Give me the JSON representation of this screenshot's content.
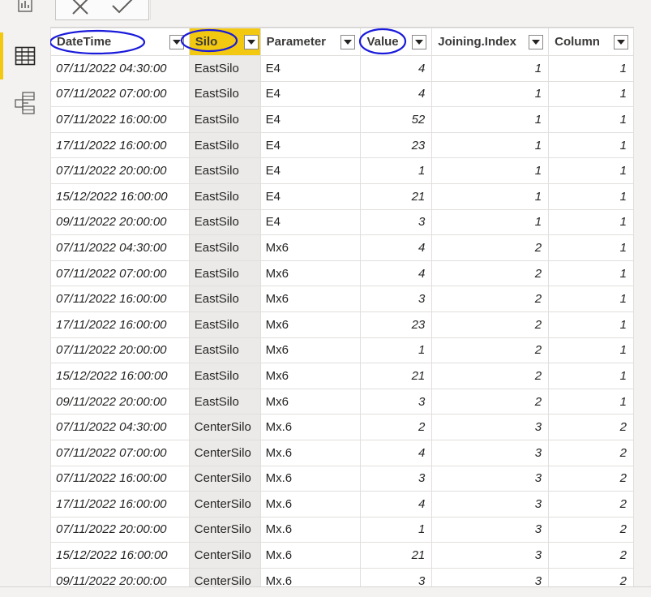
{
  "left_rail": {
    "items": [
      {
        "icon": "report-view-icon",
        "active": false
      },
      {
        "icon": "data-view-icon",
        "active": true
      },
      {
        "icon": "model-view-icon",
        "active": false
      }
    ]
  },
  "formula_bar": {
    "cancel_icon": "close-icon",
    "commit_icon": "check-icon"
  },
  "colors": {
    "accent": "#f2c811",
    "annotation_ink": "#1a1adb",
    "selected_column_bg": "#ebeae9"
  },
  "table": {
    "columns": [
      "DateTime",
      "Silo",
      "Parameter",
      "Value",
      "Joining.Index",
      "Column"
    ],
    "selected_column": "Silo",
    "rows": [
      [
        "07/11/2022 04:30:00",
        "EastSilo",
        "E4",
        "4",
        "1",
        "1"
      ],
      [
        "07/11/2022 07:00:00",
        "EastSilo",
        "E4",
        "4",
        "1",
        "1"
      ],
      [
        "07/11/2022 16:00:00",
        "EastSilo",
        "E4",
        "52",
        "1",
        "1"
      ],
      [
        "17/11/2022 16:00:00",
        "EastSilo",
        "E4",
        "23",
        "1",
        "1"
      ],
      [
        "07/11/2022 20:00:00",
        "EastSilo",
        "E4",
        "1",
        "1",
        "1"
      ],
      [
        "15/12/2022 16:00:00",
        "EastSilo",
        "E4",
        "21",
        "1",
        "1"
      ],
      [
        "09/11/2022 20:00:00",
        "EastSilo",
        "E4",
        "3",
        "1",
        "1"
      ],
      [
        "07/11/2022 04:30:00",
        "EastSilo",
        "Mx6",
        "4",
        "2",
        "1"
      ],
      [
        "07/11/2022 07:00:00",
        "EastSilo",
        "Mx6",
        "4",
        "2",
        "1"
      ],
      [
        "07/11/2022 16:00:00",
        "EastSilo",
        "Mx6",
        "3",
        "2",
        "1"
      ],
      [
        "17/11/2022 16:00:00",
        "EastSilo",
        "Mx6",
        "23",
        "2",
        "1"
      ],
      [
        "07/11/2022 20:00:00",
        "EastSilo",
        "Mx6",
        "1",
        "2",
        "1"
      ],
      [
        "15/12/2022 16:00:00",
        "EastSilo",
        "Mx6",
        "21",
        "2",
        "1"
      ],
      [
        "09/11/2022 20:00:00",
        "EastSilo",
        "Mx6",
        "3",
        "2",
        "1"
      ],
      [
        "07/11/2022 04:30:00",
        "CenterSilo",
        "Mx.6",
        "2",
        "3",
        "2"
      ],
      [
        "07/11/2022 07:00:00",
        "CenterSilo",
        "Mx.6",
        "4",
        "3",
        "2"
      ],
      [
        "07/11/2022 16:00:00",
        "CenterSilo",
        "Mx.6",
        "3",
        "3",
        "2"
      ],
      [
        "17/11/2022 16:00:00",
        "CenterSilo",
        "Mx.6",
        "4",
        "3",
        "2"
      ],
      [
        "07/11/2022 20:00:00",
        "CenterSilo",
        "Mx.6",
        "1",
        "3",
        "2"
      ],
      [
        "15/12/2022 16:00:00",
        "CenterSilo",
        "Mx.6",
        "21",
        "3",
        "2"
      ],
      [
        "09/11/2022 20:00:00",
        "CenterSilo",
        "Mx.6",
        "3",
        "3",
        "2"
      ]
    ]
  }
}
